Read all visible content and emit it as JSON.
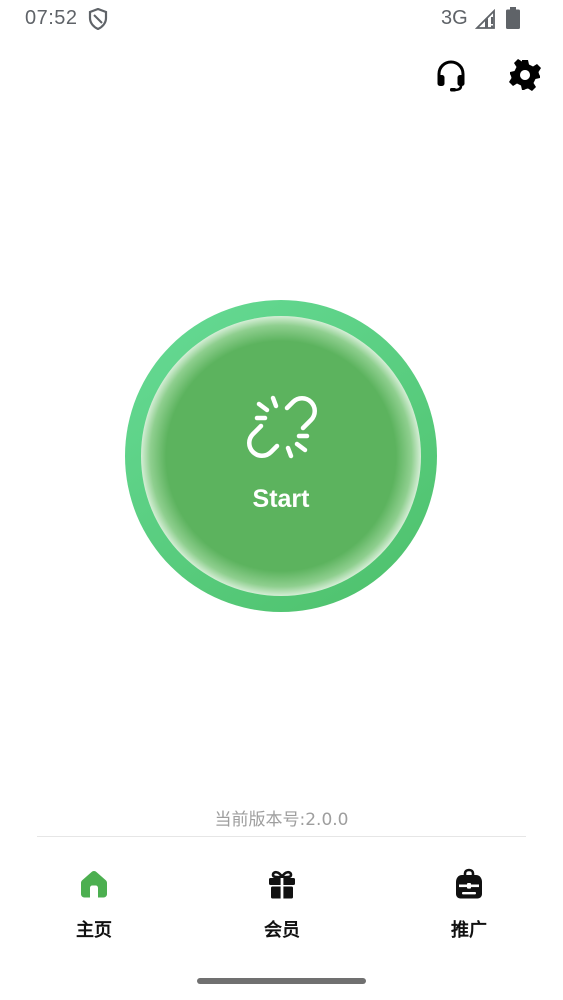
{
  "status_bar": {
    "time": "07:52",
    "network": "3G",
    "icons": [
      "shield-icon",
      "signal-icon",
      "battery-icon"
    ]
  },
  "top_actions": {
    "icons": [
      "headset-icon",
      "gear-icon"
    ]
  },
  "connect": {
    "label": "Start",
    "icon": "broken-link-icon",
    "color_outer": "#5ccf7f",
    "color_inner": "#5cb35e"
  },
  "version": {
    "text": "当前版本号:2.0.0"
  },
  "bottom_nav": {
    "items": [
      {
        "label": "主页",
        "icon": "home-icon",
        "active": true
      },
      {
        "label": "会员",
        "icon": "gift-icon",
        "active": false
      },
      {
        "label": "推广",
        "icon": "backpack-icon",
        "active": false
      }
    ],
    "active_color": "#4caf50",
    "inactive_color": "#111111"
  }
}
